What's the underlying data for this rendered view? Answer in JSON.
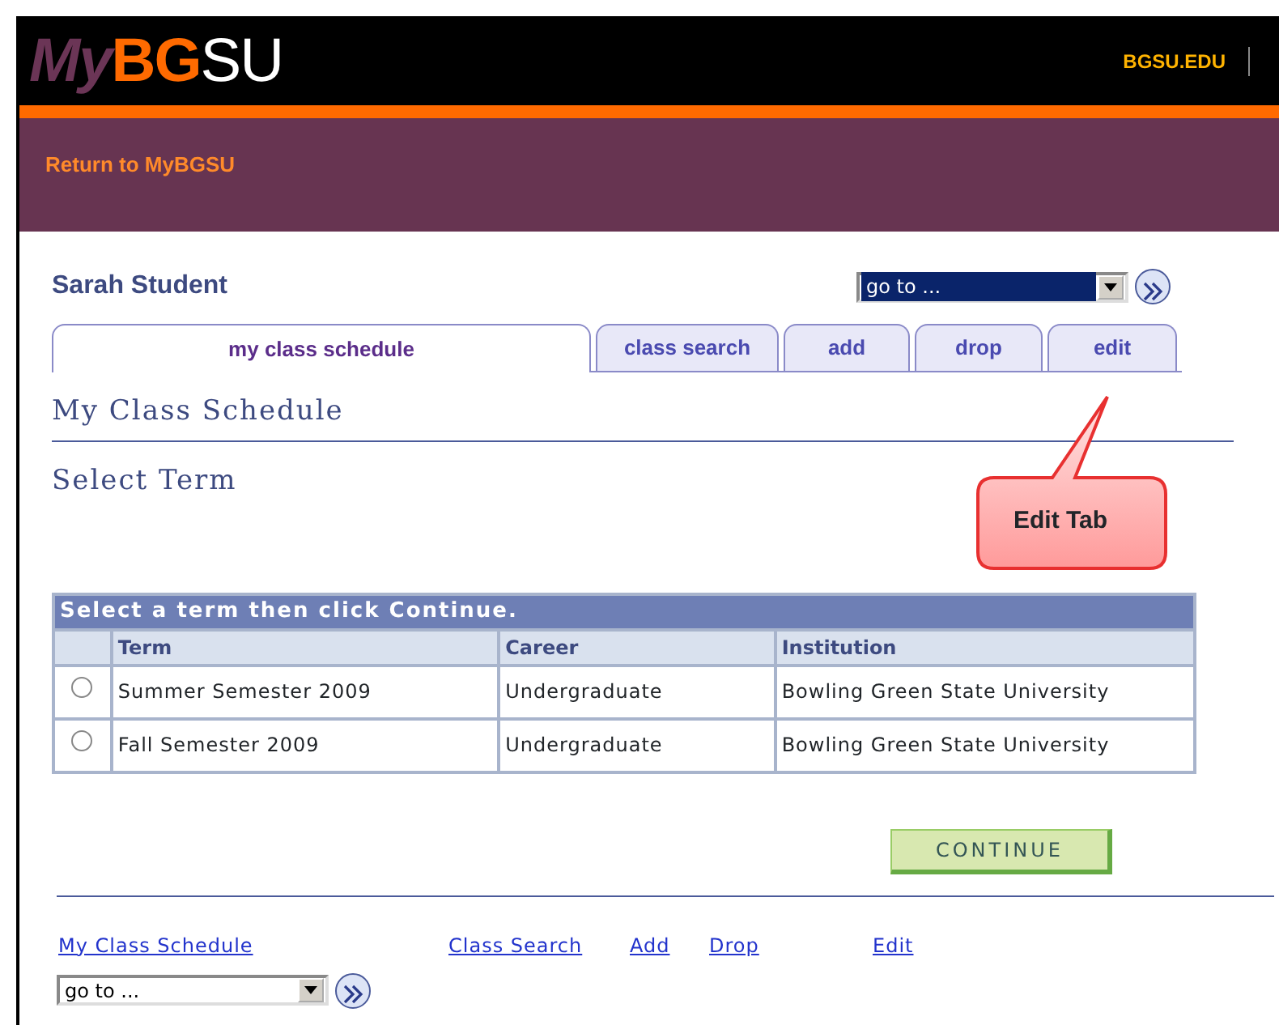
{
  "header": {
    "logo": [
      {
        "text": "My",
        "kind": "my"
      },
      {
        "text": "BG",
        "kind": "bg"
      },
      {
        "text": "SU",
        "kind": "su"
      }
    ],
    "site_link": "BGSU.EDU",
    "return_link": "Return to MyBGSU"
  },
  "student_name": "Sarah Student",
  "goto_top": {
    "value": "go to ...",
    "focused": true
  },
  "tabs": [
    {
      "label": "my class schedule",
      "selected": true
    },
    {
      "label": "class search",
      "selected": false
    },
    {
      "label": "add",
      "selected": false
    },
    {
      "label": "drop",
      "selected": false
    },
    {
      "label": "edit",
      "selected": false
    }
  ],
  "page_title": "My Class Schedule",
  "section_title": "Select Term",
  "callout": "Edit Tab",
  "table": {
    "caption": "Select a term then click Continue.",
    "columns": [
      "Term",
      "Career",
      "Institution"
    ],
    "rows": [
      {
        "selected": false,
        "cells": [
          "Summer Semester 2009",
          "Undergraduate",
          "Bowling Green State University"
        ]
      },
      {
        "selected": false,
        "cells": [
          "Fall Semester 2009",
          "Undergraduate",
          "Bowling Green State University"
        ]
      }
    ]
  },
  "continue_button": "CONTINUE",
  "footer_links": [
    "My Class Schedule",
    "Class Search",
    "Add",
    "Drop",
    "Edit"
  ],
  "goto_bottom": {
    "value": "go to ...",
    "focused": false
  }
}
